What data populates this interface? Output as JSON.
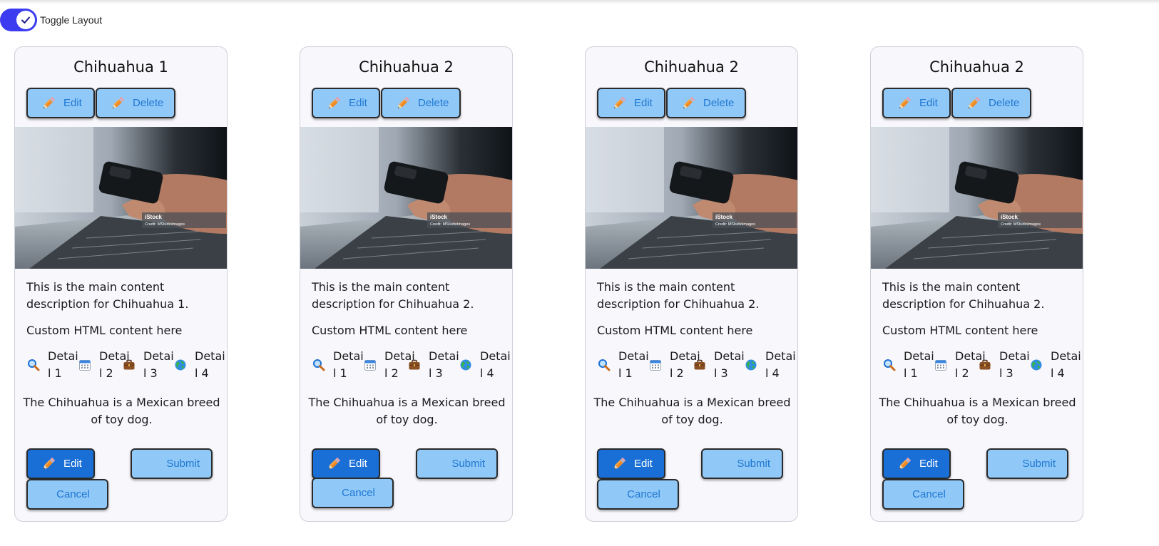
{
  "toggle": {
    "label": "Toggle Layout",
    "checked": true,
    "color": "#3b3bf0"
  },
  "icons": {
    "pencil": "pencil-icon",
    "search": "magnifier-icon",
    "calendar": "calendar-icon",
    "briefcase": "briefcase-icon",
    "globe": "globe-icon",
    "check": "check-icon"
  },
  "photo": {
    "watermark_brand": "iStock",
    "watermark_credit": "Credit: MStudioImages"
  },
  "cards": [
    {
      "title": "Chihuahua 1",
      "edit_label": "Edit",
      "delete_label": "Delete",
      "description": "This is the main content description for Chihuahua 1.",
      "custom_html": "Custom HTML content here",
      "details": [
        "Detail 1",
        "Detail 2",
        "Detail 3",
        "Detail 4"
      ],
      "blurb": "The Chihuahua is a Mexican breed of toy dog.",
      "footer_edit": "Edit",
      "submit_label": "Submit",
      "cancel_label": "Cancel"
    },
    {
      "title": "Chihuahua 2",
      "edit_label": "Edit",
      "delete_label": "Delete",
      "description": "This is the main content description for Chihuahua 2.",
      "custom_html": "Custom HTML content here",
      "details": [
        "Detail 1",
        "Detail 2",
        "Detail 3",
        "Detail 4"
      ],
      "blurb": "The Chihuahua is a Mexican breed of toy dog.",
      "footer_edit": "Edit",
      "submit_label": "Submit",
      "cancel_label": "Cancel"
    },
    {
      "title": "Chihuahua 2",
      "edit_label": "Edit",
      "delete_label": "Delete",
      "description": "This is the main content description for Chihuahua 2.",
      "custom_html": "Custom HTML content here",
      "details": [
        "Detail 1",
        "Detail 2",
        "Detail 3",
        "Detail 4"
      ],
      "blurb": "The Chihuahua is a Mexican breed of toy dog.",
      "footer_edit": "Edit",
      "submit_label": "Submit",
      "cancel_label": "Cancel"
    },
    {
      "title": "Chihuahua 2",
      "edit_label": "Edit",
      "delete_label": "Delete",
      "description": "This is the main content description for Chihuahua 2.",
      "custom_html": "Custom HTML content here",
      "details": [
        "Detail 1",
        "Detail 2",
        "Detail 3",
        "Detail 4"
      ],
      "blurb": "The Chihuahua is a Mexican breed of toy dog.",
      "footer_edit": "Edit",
      "submit_label": "Submit",
      "cancel_label": "Cancel"
    }
  ]
}
